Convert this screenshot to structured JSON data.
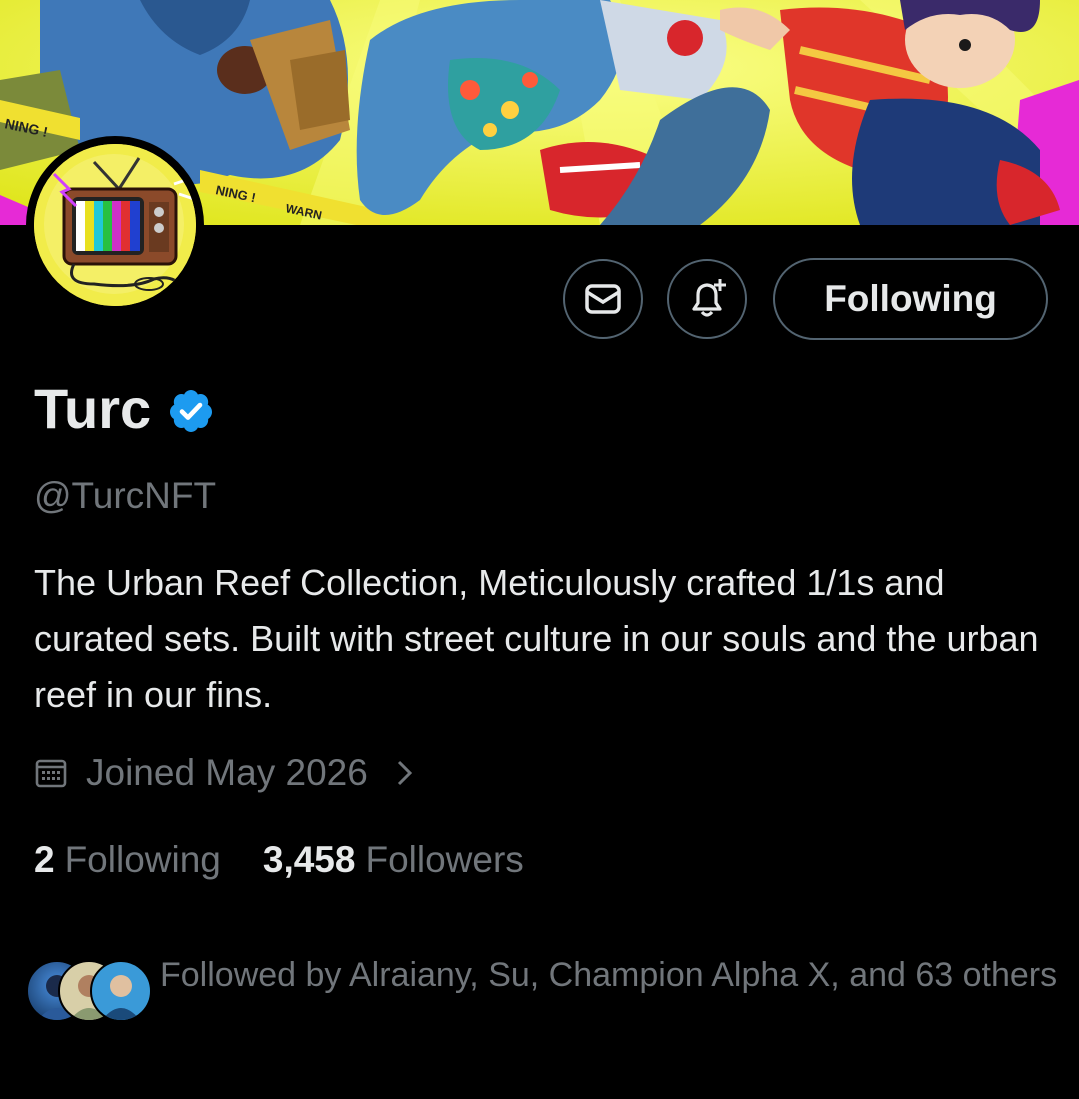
{
  "profile": {
    "name": "Turc",
    "handle": "@TurcNFT",
    "bio": "The Urban Reef Collection, Meticulously crafted 1/1s and curated sets. Built with street culture in our souls and the urban reef in our fins.",
    "joined": "Joined May 2026",
    "verified_color": "#1d9bf0"
  },
  "banner": {
    "warning_text_1": "NING !",
    "warning_text_2": "NING !",
    "warning_text_3": "WARN"
  },
  "actions": {
    "message_icon": "envelope-icon",
    "notify_icon": "bell-plus-icon",
    "follow_label": "Following"
  },
  "stats": {
    "following_count": "2",
    "following_label": "Following",
    "followers_count": "3,458",
    "followers_label": "Followers"
  },
  "followed_by": {
    "text": "Followed by Alraiany, Su, Champion Alpha X, and 63 others"
  },
  "colors": {
    "background": "#000000",
    "text_primary": "#e7e9ea",
    "text_secondary": "#71767b",
    "border": "#536471",
    "banner_yellow": "#e8ef2a"
  }
}
